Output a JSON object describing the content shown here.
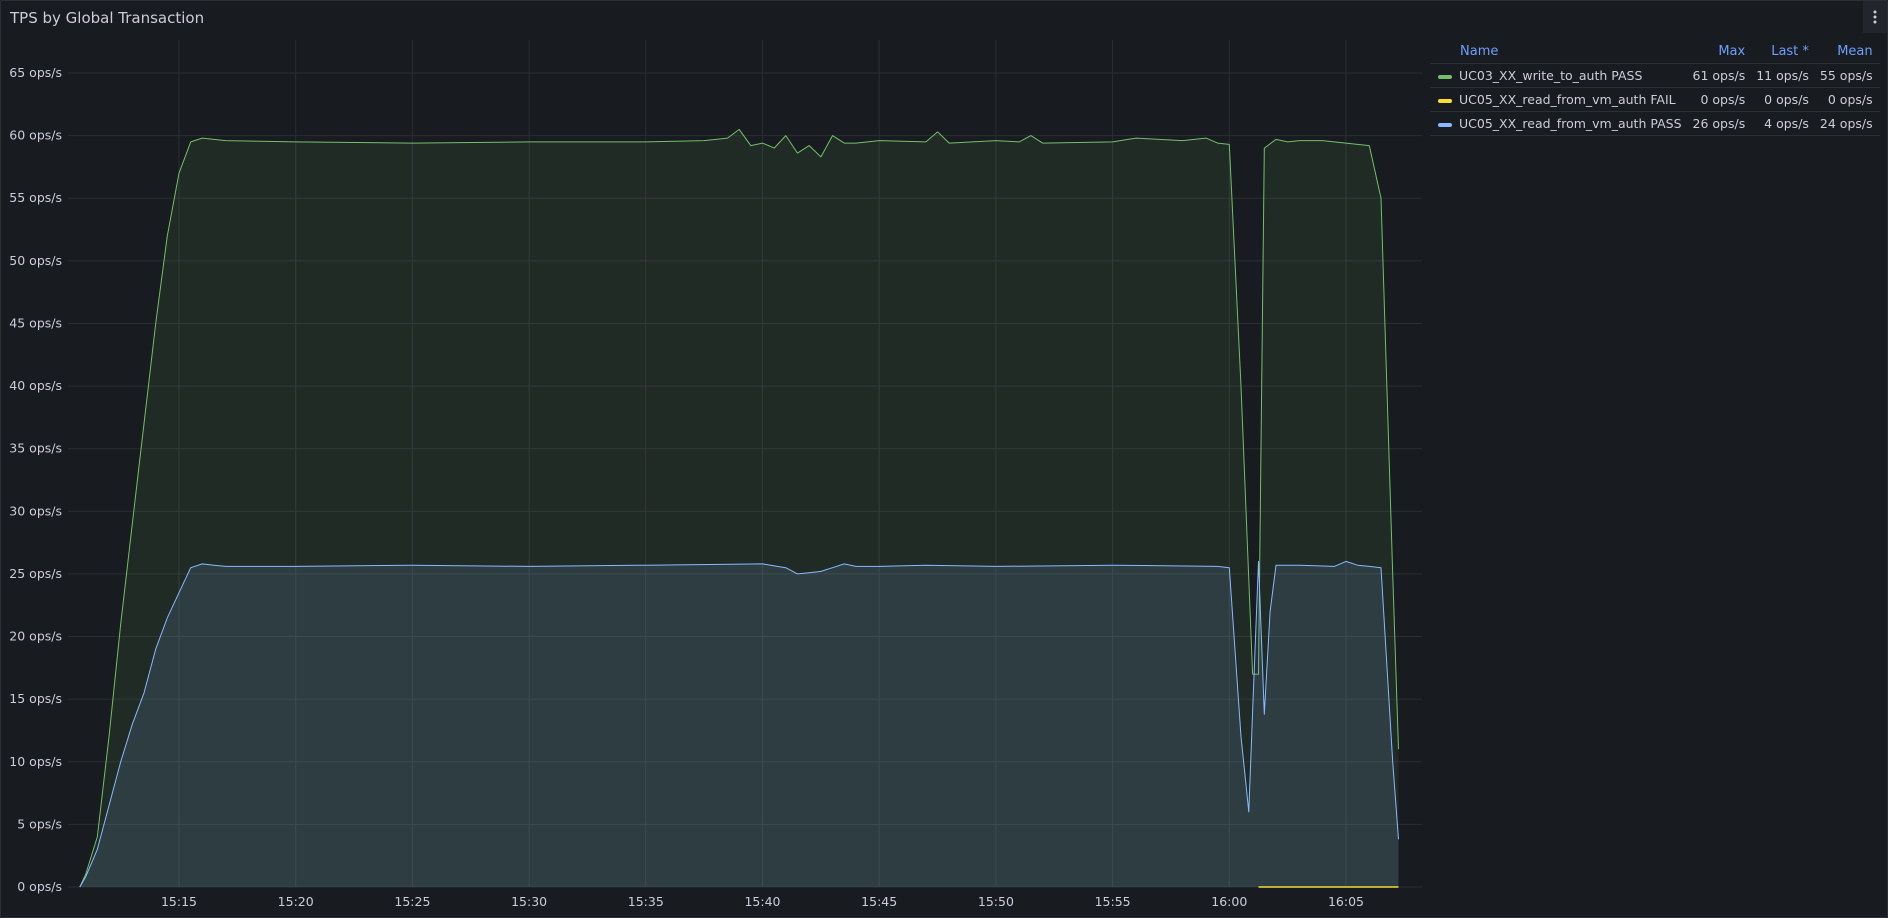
{
  "panel": {
    "title": "TPS by Global Transaction"
  },
  "legend": {
    "headers": {
      "name": "Name",
      "max": "Max",
      "last": "Last *",
      "mean": "Mean"
    },
    "rows": [
      {
        "name": "UC03_XX_write_to_auth PASS",
        "color": "#73bf69",
        "max": "61 ops/s",
        "last": "11 ops/s",
        "mean": "55 ops/s"
      },
      {
        "name": "UC05_XX_read_from_vm_auth FAIL",
        "color": "#fade2a",
        "max": "0 ops/s",
        "last": "0 ops/s",
        "mean": "0 ops/s"
      },
      {
        "name": "UC05_XX_read_from_vm_auth PASS",
        "color": "#8ab8ff",
        "max": "26 ops/s",
        "last": "4 ops/s",
        "mean": "24 ops/s"
      }
    ]
  },
  "chart_data": {
    "type": "area",
    "x_unit": "time",
    "ylim": [
      0,
      65
    ],
    "y_tick_labels": [
      "0 ops/s",
      "5 ops/s",
      "10 ops/s",
      "15 ops/s",
      "20 ops/s",
      "25 ops/s",
      "30 ops/s",
      "35 ops/s",
      "40 ops/s",
      "45 ops/s",
      "50 ops/s",
      "55 ops/s",
      "60 ops/s",
      "65 ops/s"
    ],
    "x_tick_labels": [
      "15:15",
      "15:20",
      "15:25",
      "15:30",
      "15:35",
      "15:40",
      "15:45",
      "15:50",
      "15:55",
      "16:00",
      "16:05"
    ],
    "grid": true,
    "legend_placement": "right",
    "series": [
      {
        "name": "UC03_XX_write_to_auth PASS",
        "color": "#73bf69",
        "x": [
          "15:10:45",
          "15:11:00",
          "15:11:30",
          "15:12:00",
          "15:12:30",
          "15:13:00",
          "15:13:30",
          "15:14:00",
          "15:14:30",
          "15:15:00",
          "15:15:30",
          "15:16:00",
          "15:16:30",
          "15:17:00",
          "15:20:00",
          "15:25:00",
          "15:30:00",
          "15:35:00",
          "15:37:30",
          "15:38:30",
          "15:39:00",
          "15:39:30",
          "15:40:00",
          "15:40:30",
          "15:41:00",
          "15:41:30",
          "15:42:00",
          "15:42:30",
          "15:43:00",
          "15:43:30",
          "15:44:00",
          "15:45:00",
          "15:47:00",
          "15:47:30",
          "15:48:00",
          "15:50:00",
          "15:51:00",
          "15:51:30",
          "15:52:00",
          "15:55:00",
          "15:56:00",
          "15:58:00",
          "15:59:00",
          "15:59:30",
          "16:00:00",
          "16:00:30",
          "16:01:00",
          "16:01:15",
          "16:01:30",
          "16:02:00",
          "16:02:30",
          "16:03:00",
          "16:04:00",
          "16:05:00",
          "16:06:00",
          "16:06:30",
          "16:07:00",
          "16:07:15"
        ],
        "y": [
          0,
          1,
          4,
          12,
          21,
          29,
          37,
          45,
          52,
          57,
          59.5,
          59.8,
          59.7,
          59.6,
          59.5,
          59.4,
          59.5,
          59.5,
          59.6,
          59.8,
          60.5,
          59.2,
          59.4,
          59.0,
          60.0,
          58.6,
          59.2,
          58.3,
          60.0,
          59.4,
          59.4,
          59.6,
          59.5,
          60.3,
          59.4,
          59.6,
          59.5,
          60.0,
          59.4,
          59.5,
          59.8,
          59.6,
          59.8,
          59.4,
          59.3,
          40,
          17,
          17,
          59.0,
          59.7,
          59.5,
          59.6,
          59.6,
          59.4,
          59.2,
          55,
          25,
          11
        ]
      },
      {
        "name": "UC05_XX_read_from_vm_auth FAIL",
        "color": "#fade2a",
        "x": [
          "16:01:15",
          "16:07:15"
        ],
        "y": [
          0,
          0
        ]
      },
      {
        "name": "UC05_XX_read_from_vm_auth PASS",
        "color": "#8ab8ff",
        "x": [
          "15:10:45",
          "15:11:00",
          "15:11:30",
          "15:12:00",
          "15:12:30",
          "15:13:00",
          "15:13:30",
          "15:14:00",
          "15:14:30",
          "15:15:00",
          "15:15:30",
          "15:16:00",
          "15:16:30",
          "15:17:00",
          "15:20:00",
          "15:25:00",
          "15:30:00",
          "15:35:00",
          "15:40:00",
          "15:41:00",
          "15:41:30",
          "15:42:00",
          "15:42:30",
          "15:43:00",
          "15:43:30",
          "15:44:00",
          "15:45:00",
          "15:47:00",
          "15:50:00",
          "15:55:00",
          "15:59:30",
          "16:00:00",
          "16:00:30",
          "16:00:50",
          "16:01:00",
          "16:01:15",
          "16:01:30",
          "16:01:45",
          "16:02:00",
          "16:03:00",
          "16:04:30",
          "16:05:00",
          "16:05:30",
          "16:06:00",
          "16:06:30",
          "16:07:00",
          "16:07:15"
        ],
        "y": [
          0,
          0.8,
          3,
          6.5,
          10,
          13,
          15.5,
          19,
          21.5,
          23.5,
          25.5,
          25.8,
          25.7,
          25.6,
          25.6,
          25.7,
          25.6,
          25.7,
          25.8,
          25.5,
          25.0,
          25.1,
          25.2,
          25.5,
          25.8,
          25.6,
          25.6,
          25.7,
          25.6,
          25.7,
          25.6,
          25.5,
          12,
          6,
          14,
          26,
          13.8,
          22,
          25.7,
          25.7,
          25.6,
          26.0,
          25.7,
          25.6,
          25.5,
          10,
          3.8
        ]
      }
    ]
  }
}
